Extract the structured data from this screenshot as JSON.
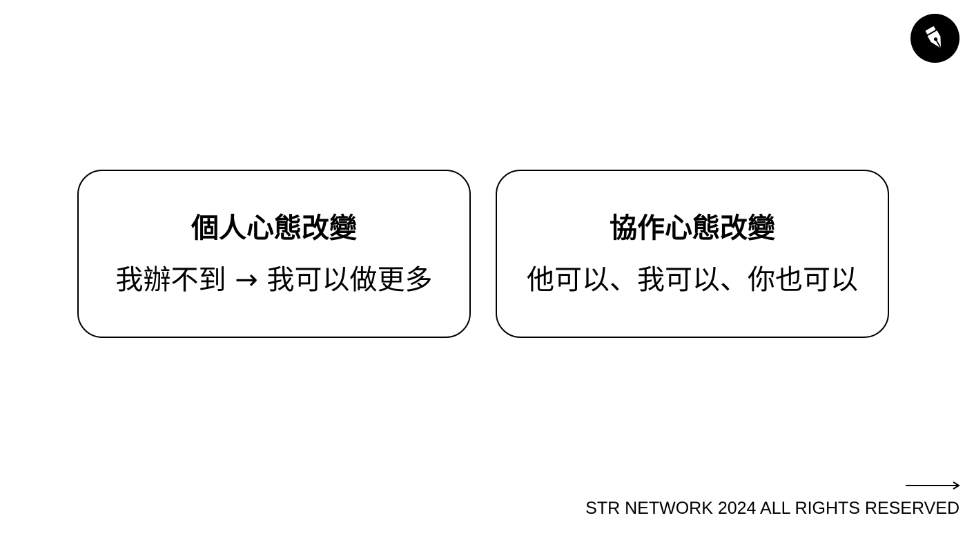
{
  "logo": {
    "icon": "fountain-pen-icon"
  },
  "cards": [
    {
      "title": "個人心態改變",
      "text": "我辦不到 → 我可以做更多"
    },
    {
      "title": "協作心態改變",
      "text": "他可以、我可以、你也可以"
    }
  ],
  "navigation": {
    "next_icon": "arrow-right-icon"
  },
  "footer": {
    "text": "STR NETWORK 2024 ALL RIGHTS RESERVED"
  },
  "colors": {
    "background": "#ffffff",
    "foreground": "#000000"
  }
}
